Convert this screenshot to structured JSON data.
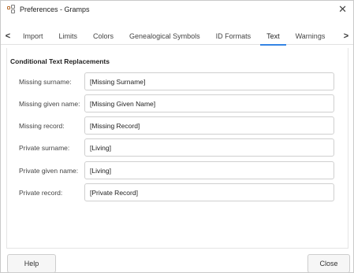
{
  "window": {
    "title": "Preferences - Gramps",
    "close_glyph": "✕"
  },
  "tabs": {
    "prev_glyph": "<",
    "next_glyph": ">",
    "items": [
      {
        "label": "Import",
        "active": false
      },
      {
        "label": "Limits",
        "active": false
      },
      {
        "label": "Colors",
        "active": false
      },
      {
        "label": "Genealogical Symbols",
        "active": false
      },
      {
        "label": "ID Formats",
        "active": false
      },
      {
        "label": "Text",
        "active": true
      },
      {
        "label": "Warnings",
        "active": false
      }
    ]
  },
  "section": {
    "title": "Conditional Text Replacements"
  },
  "rows": [
    {
      "label": "Missing surname:",
      "value": "[Missing Surname]"
    },
    {
      "label": "Missing given name:",
      "value": "[Missing Given Name]"
    },
    {
      "label": "Missing record:",
      "value": "[Missing Record]"
    },
    {
      "label": "Private surname:",
      "value": "[Living]"
    },
    {
      "label": "Private given name:",
      "value": "[Living]"
    },
    {
      "label": "Private record:",
      "value": "[Private Record]"
    }
  ],
  "buttons": {
    "help": "Help",
    "close": "Close"
  },
  "colors": {
    "accent": "#3584e4"
  }
}
